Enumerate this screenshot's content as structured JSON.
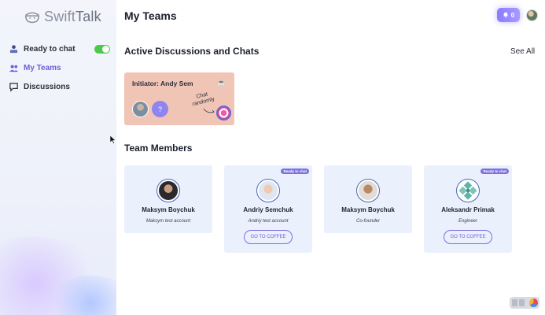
{
  "app": {
    "logo_part1": "Swift",
    "logo_part2": "Talk"
  },
  "sidebar": {
    "items": [
      {
        "label": "Ready to chat",
        "toggle_on": true
      },
      {
        "label": "My Teams",
        "active": true
      },
      {
        "label": "Discussions"
      }
    ]
  },
  "header": {
    "title": "My Teams",
    "notification_count": "0"
  },
  "discussions": {
    "title": "Active Discussions and Chats",
    "see_all": "See All",
    "card": {
      "initiator": "Initiator: Andy Sem",
      "unknown_avatar": "?",
      "random_label_1": "Chat",
      "random_label_2": "randomly"
    }
  },
  "team": {
    "title": "Team Members",
    "coffee_label": "GO TO COFFEE",
    "ready_badge": "Ready to chat",
    "members": [
      {
        "name": "Maksym Boychuk",
        "role": "Maksym test account",
        "ready": false
      },
      {
        "name": "Andriy Semchuk",
        "role": "Andriy test account",
        "ready": true
      },
      {
        "name": "Maksym Boychuk",
        "role": "Co-founder",
        "ready": false
      },
      {
        "name": "Aleksandr Primak",
        "role": "Engineer",
        "ready": true
      }
    ]
  },
  "colors": {
    "accent": "#7c70e0",
    "toggle_on": "#4cc94d",
    "chat_card_bg": "#f1c5b6",
    "member_card_bg": "#eaf0fc"
  }
}
